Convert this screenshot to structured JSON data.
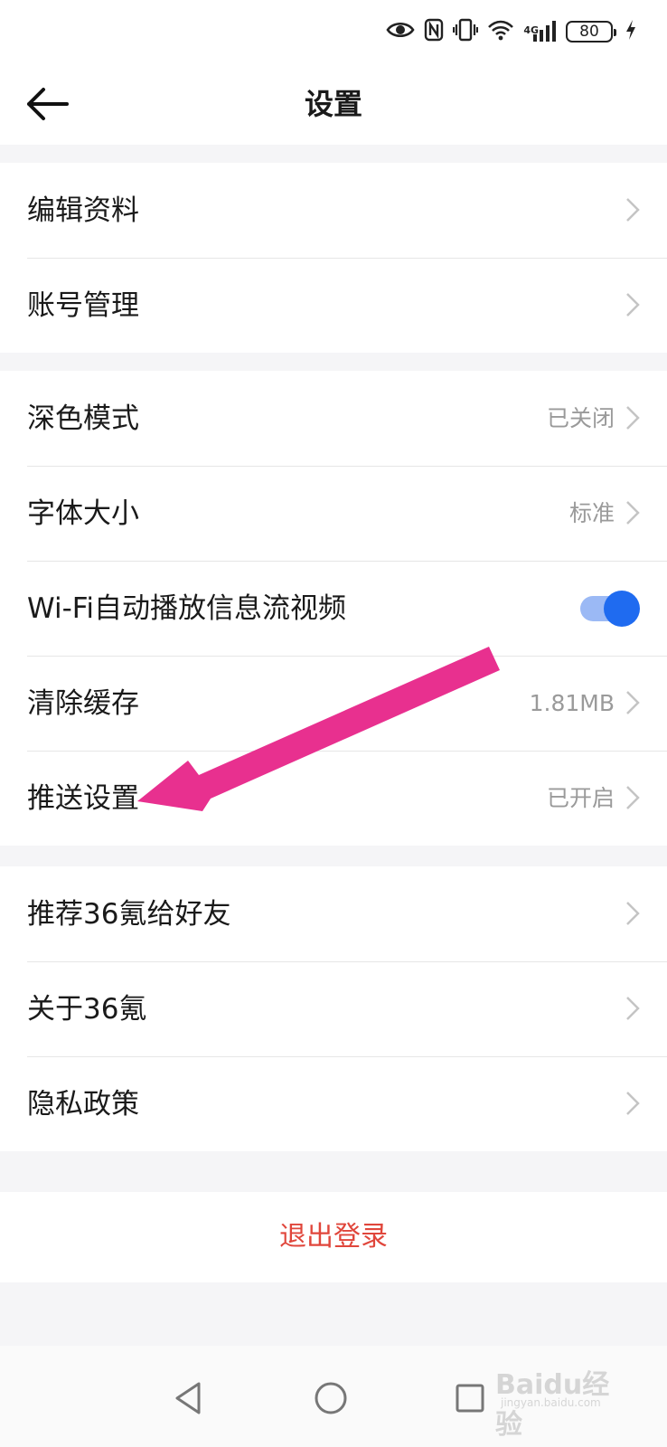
{
  "status_bar": {
    "battery_level": "80",
    "network_type": "4G",
    "icons": [
      "eye-icon",
      "nfc-icon",
      "vibrate-icon",
      "wifi-icon",
      "signal-icon",
      "battery-icon",
      "charging-icon"
    ]
  },
  "header": {
    "title": "设置",
    "back_icon": "arrow-left-icon"
  },
  "groups": [
    {
      "items": [
        {
          "label": "编辑资料",
          "value": ""
        },
        {
          "label": "账号管理",
          "value": ""
        }
      ]
    },
    {
      "items": [
        {
          "label": "深色模式",
          "value": "已关闭"
        },
        {
          "label": "字体大小",
          "value": "标准"
        },
        {
          "label": "Wi-Fi自动播放信息流视频",
          "toggle": true
        },
        {
          "label": "清除缓存",
          "value": "1.81MB"
        },
        {
          "label": "推送设置",
          "value": "已开启"
        }
      ]
    },
    {
      "items": [
        {
          "label": "推荐36氪给好友",
          "value": ""
        },
        {
          "label": "关于36氪",
          "value": ""
        },
        {
          "label": "隐私政策",
          "value": ""
        }
      ]
    }
  ],
  "logout": {
    "label": "退出登录"
  },
  "nav_bar": {
    "icons": [
      "back-triangle-icon",
      "home-circle-icon",
      "recents-square-icon"
    ]
  },
  "watermark": {
    "brand": "Baidu经验",
    "url": "jingyan.baidu.com"
  },
  "colors": {
    "accent": "#1f6bf0",
    "toggle_track": "#9bb9f5",
    "logout_text": "#e0463b",
    "annotation_arrow": "#e8308f",
    "value_text": "#9a9a9a"
  }
}
